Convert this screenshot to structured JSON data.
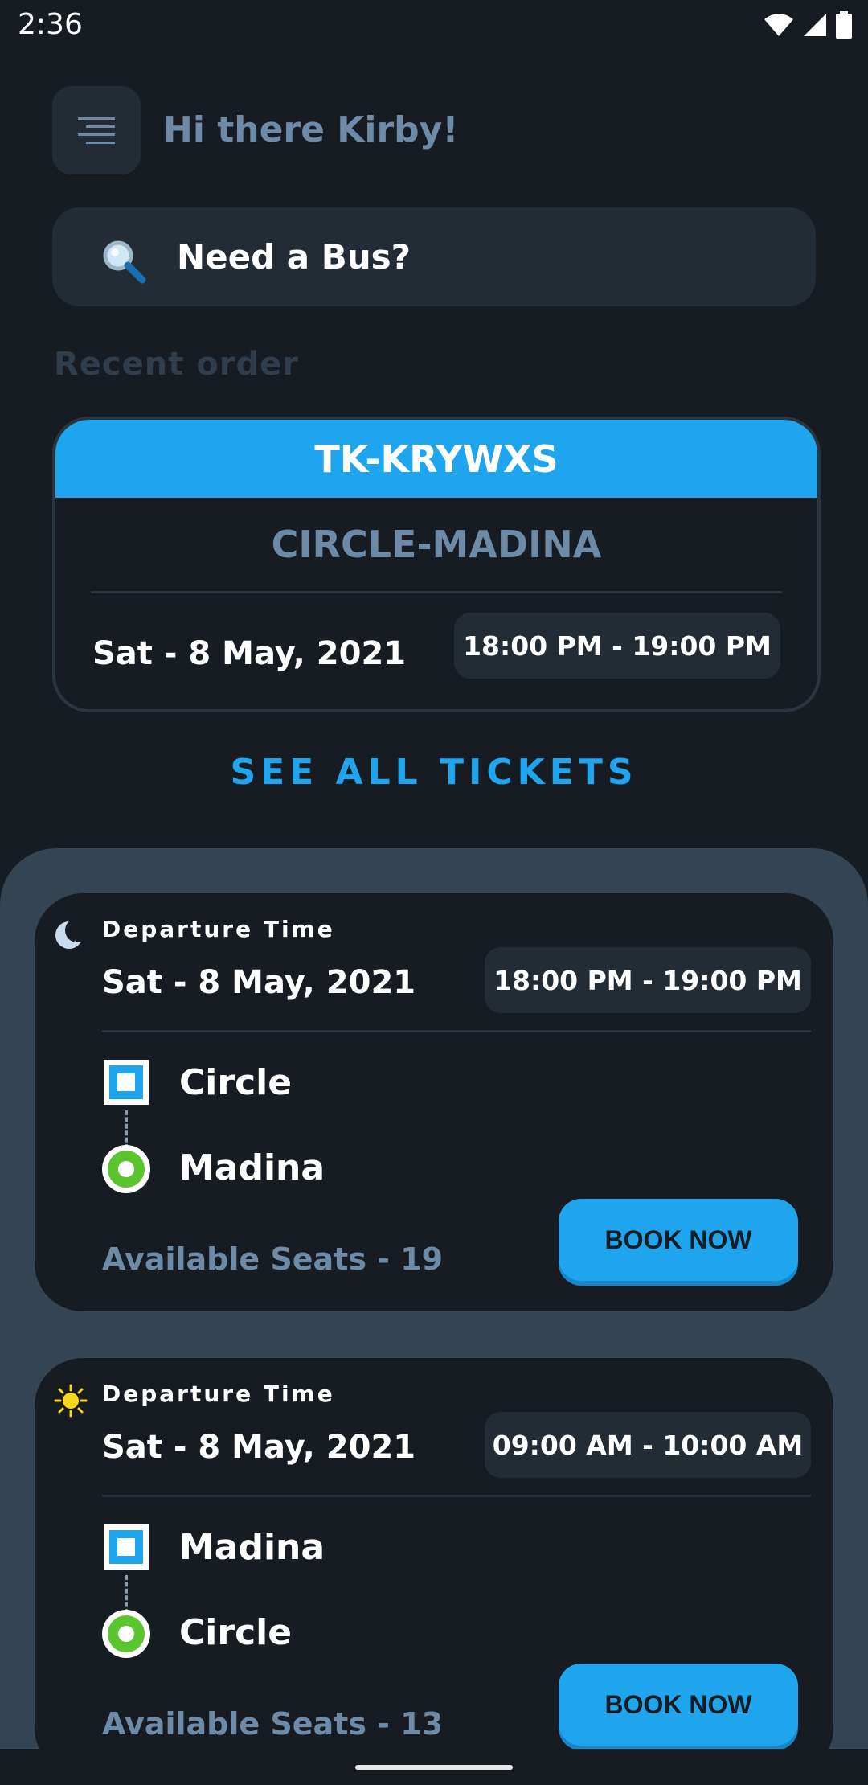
{
  "status_bar": {
    "time": "2:36"
  },
  "header": {
    "greeting": "Hi there Kirby!"
  },
  "search": {
    "label": "Need a Bus?"
  },
  "recent": {
    "section_label": "Recent order",
    "ticket_code": "TK-KRYWXS",
    "route": "CIRCLE-MADINA",
    "date": "Sat - 8 May, 2021",
    "time": "18:00 PM - 19:00 PM"
  },
  "see_all_label": "SEE ALL TICKETS",
  "trips": [
    {
      "period_icon": "moon-icon",
      "departure_label": "Departure Time",
      "date": "Sat - 8 May, 2021",
      "time": "18:00 PM - 19:00 PM",
      "from": "Circle",
      "to": "Madina",
      "seats": "Available Seats - 19",
      "button": "BOOK NOW"
    },
    {
      "period_icon": "sun-icon",
      "departure_label": "Departure Time",
      "date": "Sat - 8 May, 2021",
      "time": "09:00 AM - 10:00 AM",
      "from": "Madina",
      "to": "Circle",
      "seats": "Available Seats - 13",
      "button": "BOOK NOW"
    }
  ],
  "colors": {
    "background": "#171c23",
    "accent": "#1ea5ee",
    "muted_text": "#6d8aa7",
    "surface": "#232c35",
    "sheet": "#344452",
    "stop_green": "#5ac52c"
  }
}
